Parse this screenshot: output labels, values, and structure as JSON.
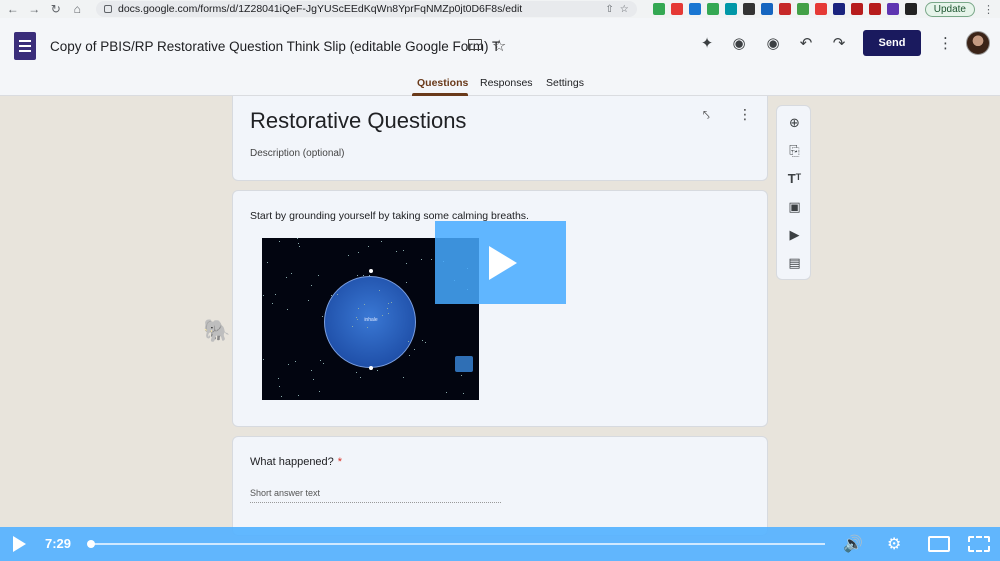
{
  "browser": {
    "url": "docs.google.com/forms/d/1Z28041iQeF-JgYUScEEdKqWn8YprFqNMZp0jt0D6F8s/edit",
    "update_label": "Update",
    "extension_colors": [
      "#34a853",
      "#e53935",
      "#1976d2",
      "#34a853",
      "#0097a7",
      "#333333",
      "#1565c0",
      "#c62828",
      "#43a047",
      "#e53935",
      "#1a237e",
      "#b71c1c",
      "#b71c1c",
      "#5e35b1",
      "#222222"
    ]
  },
  "header": {
    "doc_title": "Copy of PBIS/RP Restorative Question Think Slip (editable Google Form) T",
    "send_label": "Send",
    "tabs": [
      {
        "label": "Questions",
        "active": true
      },
      {
        "label": "Responses",
        "active": false
      },
      {
        "label": "Settings",
        "active": false
      }
    ]
  },
  "form": {
    "section_title": "Restorative Questions",
    "description_placeholder": "Description (optional)",
    "video_prompt": "Start by grounding yourself by taking some calming breaths.",
    "video_overlay_text": "inhale",
    "question": {
      "text": "What happened?",
      "required_mark": "*",
      "placeholder": "Short answer text"
    }
  },
  "toolbar": {
    "items": [
      "add-question",
      "import-questions",
      "add-title",
      "add-image",
      "add-video",
      "add-section"
    ]
  },
  "player": {
    "time": "7:29",
    "progress": 0.0,
    "color": "#55b2ff"
  }
}
